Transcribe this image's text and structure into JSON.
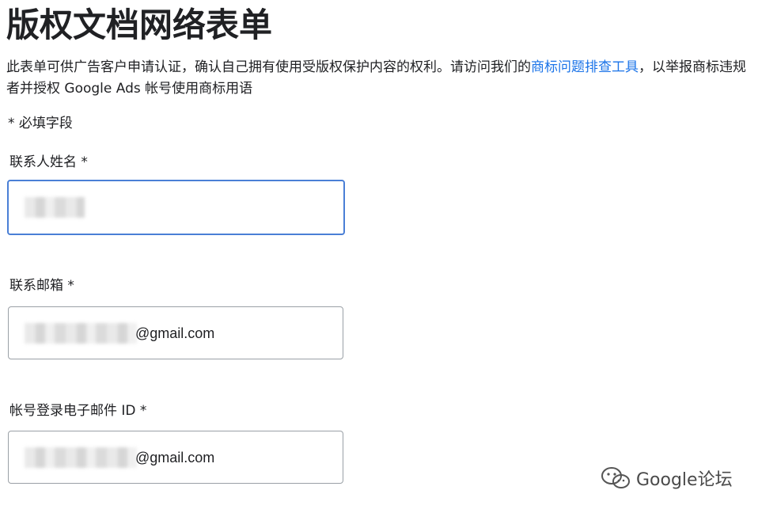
{
  "page": {
    "title": "版权文档网络表单",
    "intro_before_link": "此表单可供广告客户申请认证，确认自己拥有使用受版权保护内容的权利。请访问我们的",
    "intro_link": "商标问题排查工具",
    "intro_after_link": "，以举报商标违规者并授权 Google Ads 帐号使用商标用语",
    "required_note": "* 必填字段"
  },
  "fields": {
    "contact_name": {
      "label": "联系人姓名 *",
      "value": ""
    },
    "contact_email": {
      "label": "联系邮箱 *",
      "value_suffix": "@gmail.com"
    },
    "login_email": {
      "label": "帐号登录电子邮件 ID *",
      "value_suffix": "@gmail.com"
    }
  },
  "watermark": {
    "text": "Google论坛",
    "icon": "wechat-icon"
  },
  "colors": {
    "link": "#1a73e8",
    "focus_border": "#4a7fd6",
    "field_border": "#9aa0a6",
    "text": "#202124"
  }
}
